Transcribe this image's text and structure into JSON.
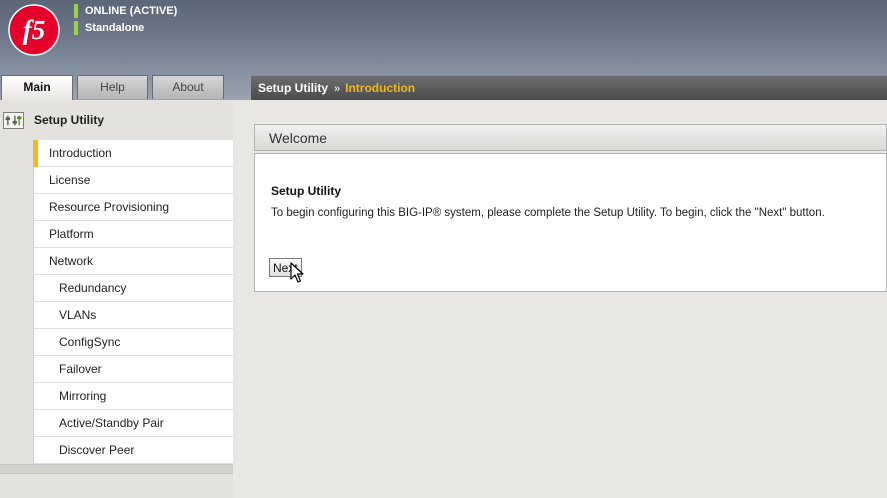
{
  "header": {
    "logo_text": "f5",
    "status_online": "ONLINE (ACTIVE)",
    "status_mode": "Standalone",
    "status_color": "#9bd04b"
  },
  "tabs": [
    {
      "label": "Main",
      "selected": true
    },
    {
      "label": "Help",
      "selected": false
    },
    {
      "label": "About",
      "selected": false
    }
  ],
  "breadcrumb": {
    "root": "Setup Utility",
    "separator": "»",
    "current": "Introduction",
    "current_color": "#f1b71c"
  },
  "sidebar": {
    "title": "Setup Utility",
    "title_icon": "setup-utility-icon",
    "items": [
      {
        "label": "Introduction",
        "level": 1,
        "active": true
      },
      {
        "label": "License",
        "level": 1
      },
      {
        "label": "Resource Provisioning",
        "level": 1
      },
      {
        "label": "Platform",
        "level": 1
      },
      {
        "label": "Network",
        "level": 1
      },
      {
        "label": "Redundancy",
        "level": 2
      },
      {
        "label": "VLANs",
        "level": 2
      },
      {
        "label": "ConfigSync",
        "level": 2
      },
      {
        "label": "Failover",
        "level": 2
      },
      {
        "label": "Mirroring",
        "level": 2
      },
      {
        "label": "Active/Standby Pair",
        "level": 2
      },
      {
        "label": "Discover Peer",
        "level": 2
      }
    ]
  },
  "main": {
    "section_header": "Welcome",
    "panel_title": "Setup Utility",
    "panel_text": "To begin configuring this BIG-IP® system, please complete the Setup Utility. To begin, click the \"Next\" button.",
    "next_label": "Next"
  }
}
